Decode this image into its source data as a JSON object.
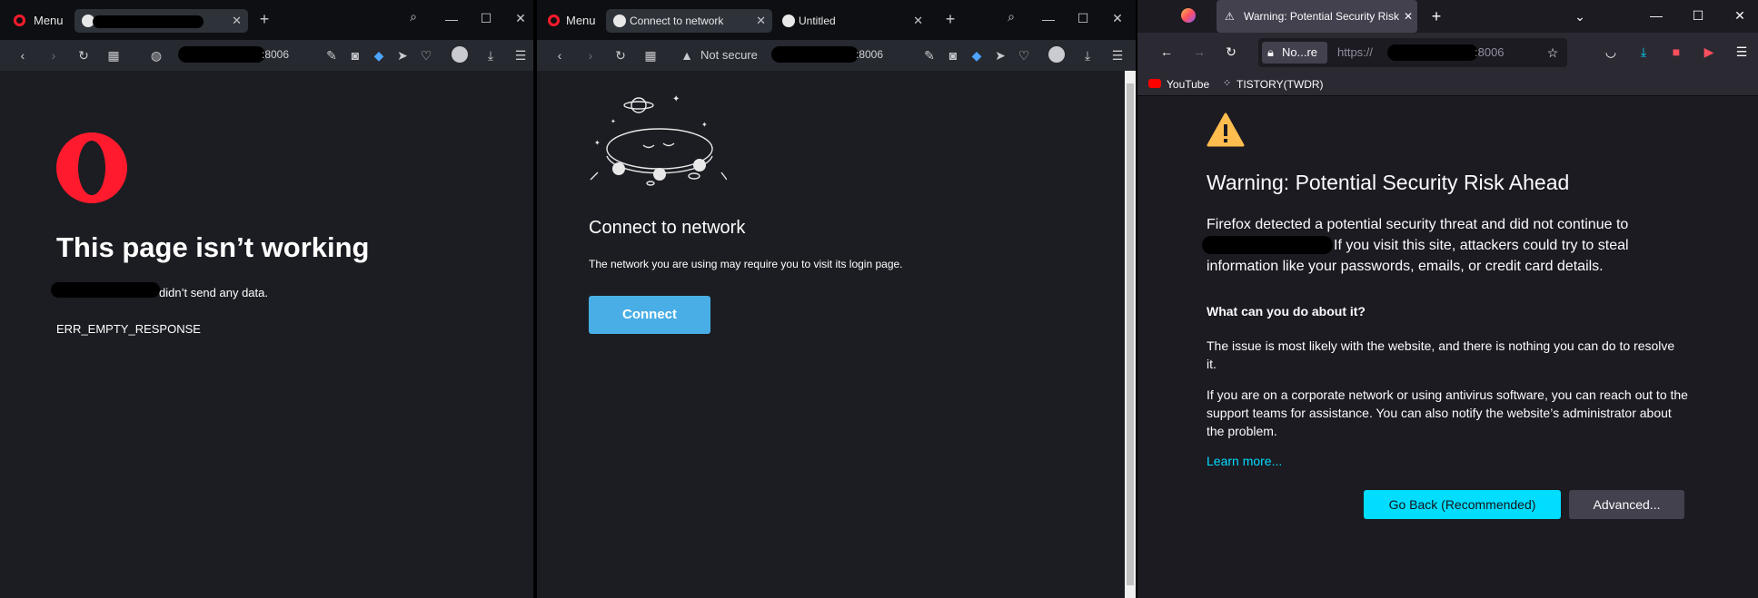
{
  "opera1": {
    "menu_label": "Menu",
    "url_suffix": ":8006",
    "page_title": "This page isn’t working",
    "message_suffix": "didn’t send any data.",
    "error_code": "ERR_EMPTY_RESPONSE"
  },
  "opera2": {
    "menu_label": "Menu",
    "tabs": [
      {
        "label": "Connect to network"
      },
      {
        "label": "Untitled"
      }
    ],
    "not_secure_label": "Not secure",
    "url_suffix": ":8006",
    "page_title": "Connect to network",
    "message": "The network you are using may require you to visit its login page.",
    "connect_label": "Connect"
  },
  "firefox": {
    "tab_label": "Warning: Potential Security Risk Ahead",
    "identity_label": "No...re",
    "url_prefix": "https://",
    "url_suffix": ":8006",
    "bookmarks": [
      {
        "label": "YouTube"
      },
      {
        "label": "TISTORY(TWDR)"
      }
    ],
    "page_title": "Warning: Potential Security Risk Ahead",
    "intro_part1": "Firefox detected a potential security threat and did not continue to",
    "intro_part2": "If you visit this site, attackers could try to steal",
    "intro_part3": "information like your passwords, emails, or credit card details.",
    "what_heading": "What can you do about it?",
    "para1": "The issue is most likely with the website, and there is nothing you can do to resolve it.",
    "para2": "If you are on a corporate network or using antivirus software, you can reach out to the support teams for assistance. You can also notify the website’s administrator about the problem.",
    "learn_more": "Learn more...",
    "go_back_label": "Go Back (Recommended)",
    "advanced_label": "Advanced..."
  },
  "colors": {
    "opera_red": "#ff1b2d",
    "connect_blue": "#49aee6",
    "firefox_accent": "#00ddff",
    "warning_yellow": "#ffbd4f"
  }
}
